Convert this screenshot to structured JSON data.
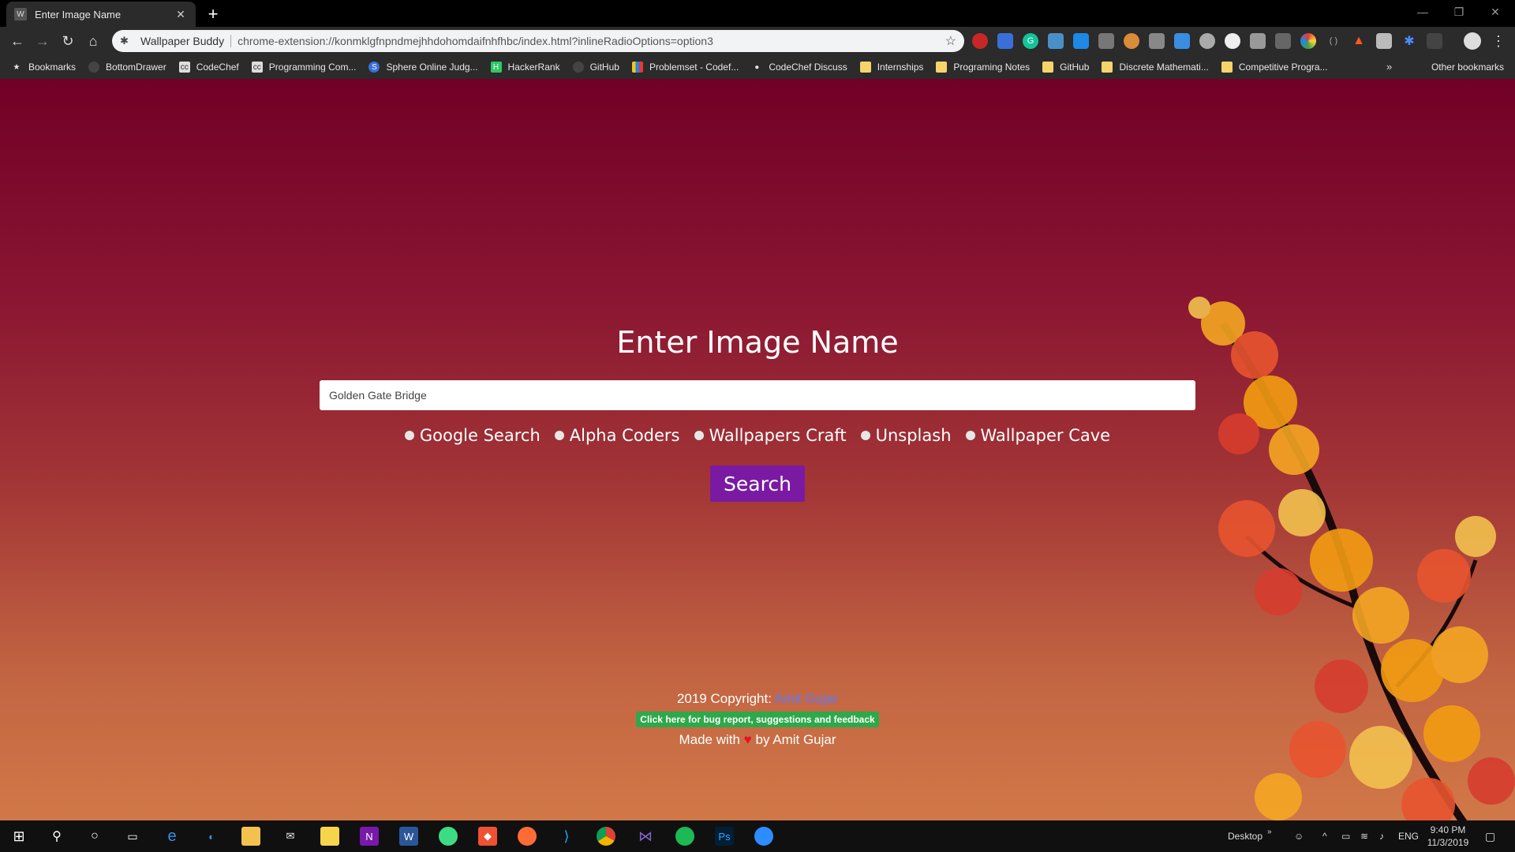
{
  "browser": {
    "tab": {
      "title": "Enter Image Name",
      "favicon": "W"
    },
    "address": {
      "site_name": "Wallpaper Buddy",
      "url": "chrome-extension://konmklgfnpndmejhhdohomdaifnhfhbc/index.html?inlineRadioOptions=option3"
    },
    "bookmarks": [
      {
        "label": "Bookmarks",
        "icon": "star-icon"
      },
      {
        "label": "BottomDrawer",
        "icon": "github-icon"
      },
      {
        "label": "CodeChef",
        "icon": "codechef-icon"
      },
      {
        "label": "Programming Com...",
        "icon": "codechef-icon"
      },
      {
        "label": "Sphere Online Judg...",
        "icon": "spoj-icon"
      },
      {
        "label": "HackerRank",
        "icon": "hackerrank-icon"
      },
      {
        "label": "GitHub",
        "icon": "github-icon"
      },
      {
        "label": "Problemset - Codef...",
        "icon": "codeforces-icon"
      },
      {
        "label": "CodeChef Discuss",
        "icon": "codechef-discuss-icon"
      },
      {
        "label": "Internships",
        "icon": "folder-icon"
      },
      {
        "label": "Programing Notes",
        "icon": "folder-icon"
      },
      {
        "label": "GitHub",
        "icon": "folder-icon"
      },
      {
        "label": "Discrete Mathemati...",
        "icon": "folder-icon"
      },
      {
        "label": "Competitive Progra...",
        "icon": "folder-icon"
      }
    ],
    "other_bookmarks": "Other bookmarks",
    "more": "»"
  },
  "page": {
    "heading": "Enter Image Name",
    "search_value": "Golden Gate Bridge",
    "radios": [
      {
        "label": "Google Search"
      },
      {
        "label": "Alpha Coders"
      },
      {
        "label": "Wallpapers Craft"
      },
      {
        "label": "Unsplash"
      },
      {
        "label": "Wallpaper Cave"
      }
    ],
    "search_button": "Search",
    "footer": {
      "copyright_prefix": "2019 Copyright:",
      "author": "Amit Gujar",
      "feedback": "Click here for bug report, suggestions and feedback",
      "made_prefix": "Made with",
      "heart": "♥",
      "made_suffix": "by Amit Gujar"
    }
  },
  "taskbar": {
    "desktop_label": "Desktop",
    "language": "ENG",
    "time": "9:40 PM",
    "date": "11/3/2019"
  },
  "colors": {
    "accent_button": "#7a1aa3",
    "feedback_badge": "#2ea84a",
    "link": "#5b7bff",
    "heart": "#e81123"
  }
}
